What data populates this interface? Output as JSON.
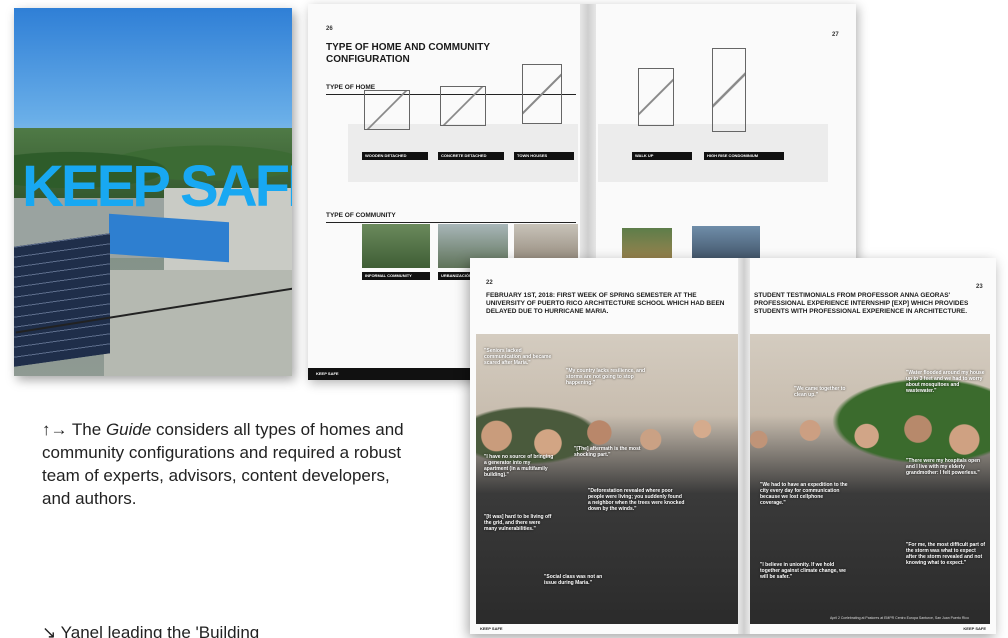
{
  "cover": {
    "title": "KEEP SAFE"
  },
  "back_spread": {
    "left_page_number": "26",
    "right_page_number": "27",
    "title": "TYPE OF HOME AND COMMUNITY CONFIGURATION",
    "home_section": "TYPE OF HOME",
    "community_section": "TYPE OF COMMUNITY",
    "home_types": [
      "WOODEN DETACHED",
      "CONCRETE DETACHED",
      "TOWN HOUSES",
      "WALK UP",
      "HIGH RISE CONDOMINIUM"
    ],
    "community_types": [
      "INFORMAL COMMUNITY",
      "URBANIZACIÓN"
    ],
    "footer": "KEEP SAFE"
  },
  "front_spread": {
    "left_page_number": "22",
    "right_page_number": "23",
    "left_title": "FEBRUARY 1ST, 2018: FIRST WEEK OF SPRING SEMESTER AT THE UNIVERSITY OF PUERTO RICO ARCHITECTURE SCHOOL WHICH HAD BEEN DELAYED DUE TO HURRICANE MARIA.",
    "right_title": "STUDENT TESTIMONIALS FROM PROFESSOR ANNA GEORAS' PROFESSIONAL EXPERIENCE INTERNSHIP [EXP] WHICH PROVIDES STUDENTS WITH PROFESSIONAL EXPERIENCE IN ARCHITECTURE.",
    "quotes": [
      "\"Seniors lacked communication and became scared after Maria.\"",
      "\"My country lacks resilience, and storms are not going to stop happening.\"",
      "\"I have no source of bringing a generator into my apartment (in a multifamily building).\"",
      "\"[The] aftermath is the most shocking part.\"",
      "\"Deforestation revealed where poor people were living; you suddenly found a neighbor when the trees were knocked down by the winds.\"",
      "\"[It was] hard to be living off the grid, and there were many vulnerabilities.\"",
      "\"Social class was not an issue during Maria.\"",
      "\"We came together to clean up.\"",
      "\"Water flooded around my house up to 3 feet and we had to worry about mosquitoes and wastewater.\"",
      "\"There were my hospitals open and I live with my elderly grandmother: I felt powerless.\"",
      "\"We had to have an expedition to the city every day for communication because we lost cellphone coverage.\"",
      "\"I believe in unionity. If we hold together against climate change, we will be safer.\"",
      "\"For me, the most difficult part of the storm was what to expect after the storm revealed and not knowing what to expect.\""
    ],
    "photo_caption": "April 2 Ccelebrating at Pastores at EMPR Centro Europa Santurce, San Juan Puerto Rico",
    "footer_left": "KEEP SAFE",
    "footer_right": "KEEP SAFE"
  },
  "caption": {
    "arrows": "↑→",
    "text_before": " The ",
    "italic": "Guide",
    "text_after": " considers all types of homes and community configurations and required a robust team of experts, advisors, content developers, and authors."
  },
  "caption2": {
    "text": "↘ Yanel leading the 'Building"
  }
}
